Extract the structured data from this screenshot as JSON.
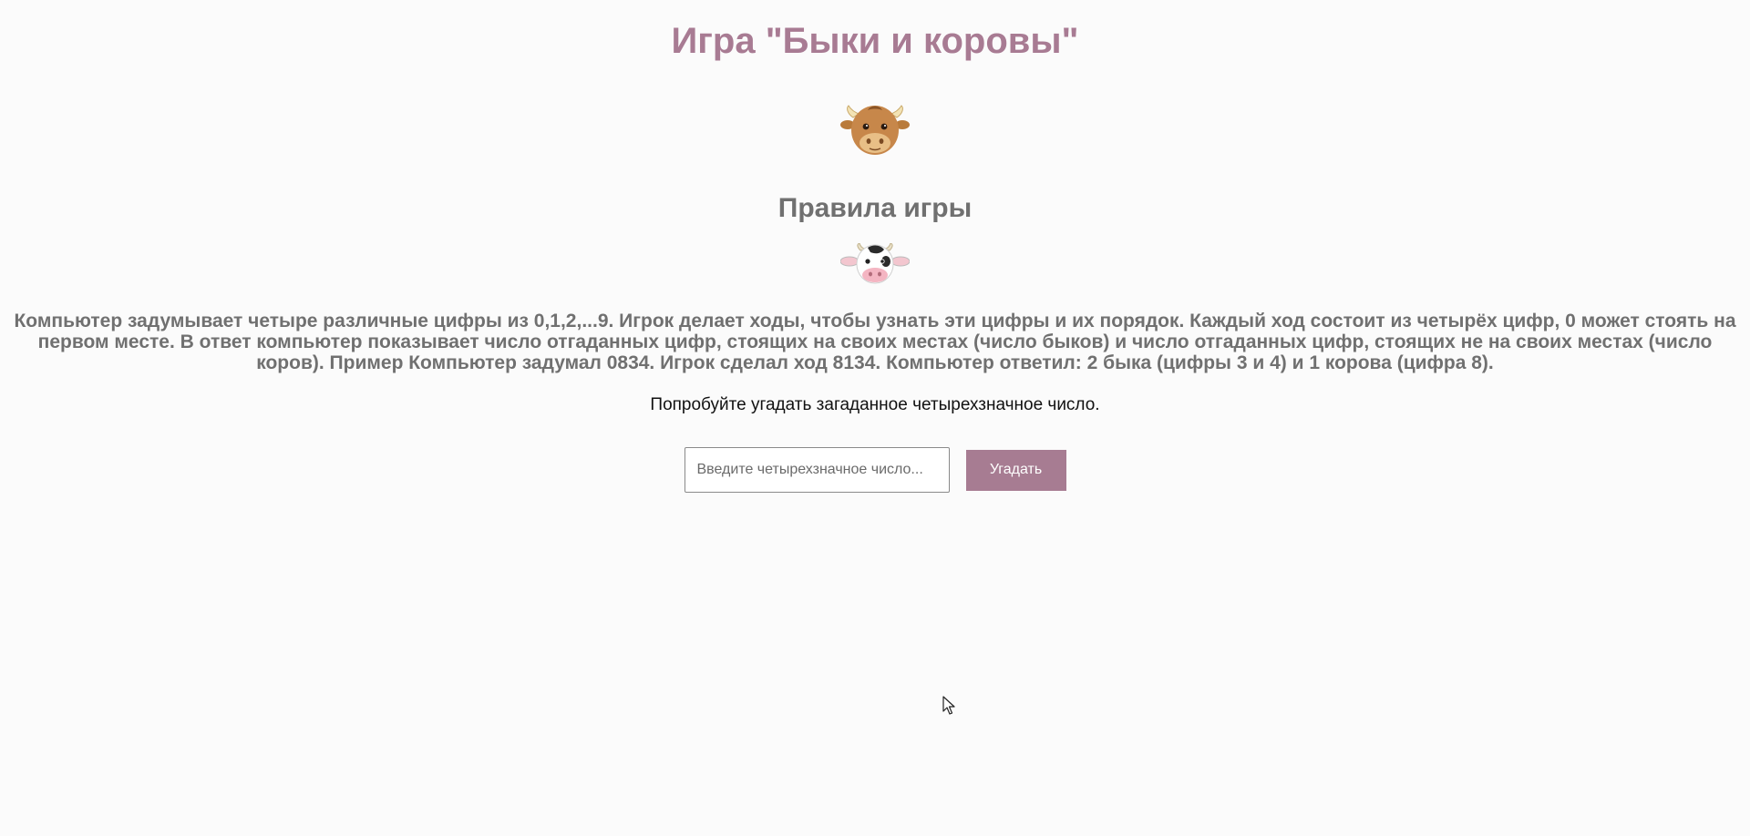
{
  "header": {
    "title": "Игра \"Быки и коровы\""
  },
  "icons": {
    "bull": "bull-face-icon",
    "cow": "cow-face-icon"
  },
  "rules": {
    "heading": "Правила игры",
    "text": "Компьютер задумывает четыре различные цифры из 0,1,2,...9. Игрок делает ходы, чтобы узнать эти цифры и их порядок. Каждый ход состоит из четырёх цифр, 0 может стоять на первом месте. В ответ компьютер показывает число отгаданных цифр, стоящих на своих местах (число быков) и число отгаданных цифр, стоящих не на своих местах (число коров). Пример Компьютер задумал 0834. Игрок сделал ход 8134. Компьютер ответил: 2 быка (цифры 3 и 4) и 1 корова (цифра 8)."
  },
  "game": {
    "prompt": "Попробуйте угадать загаданное четырехзначное число.",
    "input_value": "",
    "input_placeholder": "Введите четырехзначное число...",
    "button_label": "Угадать"
  },
  "colors": {
    "accent": "#a87b93",
    "text_gray": "#707070",
    "background": "#fbfbfb"
  }
}
